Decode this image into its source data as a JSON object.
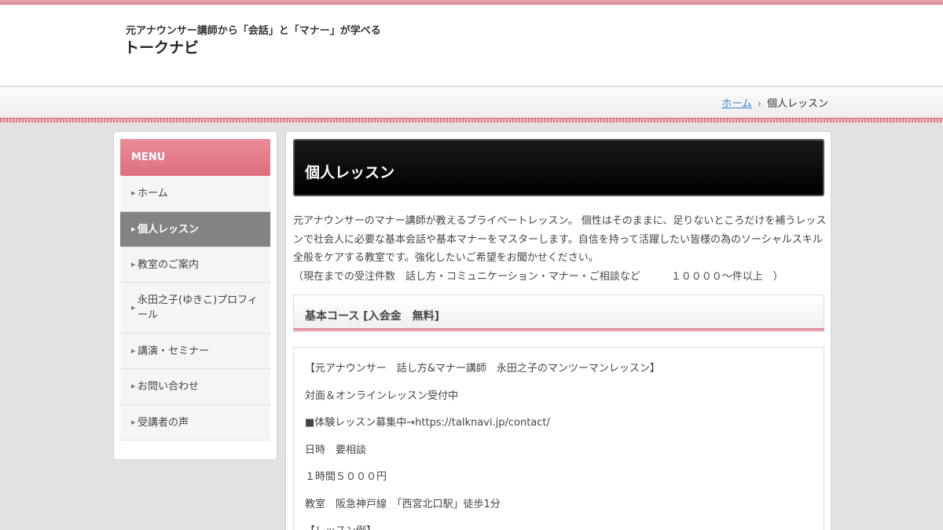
{
  "header": {
    "tagline": "元アナウンサー講師から「会話」と「マナー」が学べる",
    "site_name": "トークナビ"
  },
  "breadcrumb": {
    "home": "ホーム",
    "separator": "›",
    "current": "個人レッスン"
  },
  "sidebar": {
    "menu_title": "MENU",
    "items": [
      {
        "label": "ホーム",
        "active": false
      },
      {
        "label": "個人レッスン",
        "active": true
      },
      {
        "label": "教室のご案内",
        "active": false
      },
      {
        "label": "永田之子(ゆきこ)プロフィール",
        "active": false
      },
      {
        "label": "講演・セミナー",
        "active": false
      },
      {
        "label": "お問い合わせ",
        "active": false
      },
      {
        "label": "受講者の声",
        "active": false
      }
    ]
  },
  "main": {
    "title": "個人レッスン",
    "intro_lines": [
      "元アナウンサーのマナー講師が教えるプライベートレッスン。 個性はそのままに、足りないところだけを補うレッス",
      "ンで社会人に必要な基本会話や基本マナーをマスターします。自信を持って活躍したい皆様の為のソーシャルスキル",
      "全般をケアする教室です。強化したいご希望をお聞かせください。",
      "（現在までの受注件数　話し方・コミュニケーション・マナー・ご相談など　　　１００００〜件以上　）"
    ],
    "section_title": "基本コース [入会金　無料]",
    "content_lines": [
      "【元アナウンサー　話し方&マナー講師　永田之子のマンツーマンレッスン】",
      "対面＆オンラインレッスン受付中",
      "■体験レッスン募集中→https://talknavi.jp/contact/",
      "日時　要相談",
      "１時間５０００円",
      "教室　阪急神戸線　「西宮北口駅」徒歩1分",
      "【レッスン例】"
    ]
  },
  "colors": {
    "accent_pink": "#dd6e7f",
    "active_menu": "#838383",
    "title_bar": "#000000",
    "link": "#3b86c8"
  }
}
